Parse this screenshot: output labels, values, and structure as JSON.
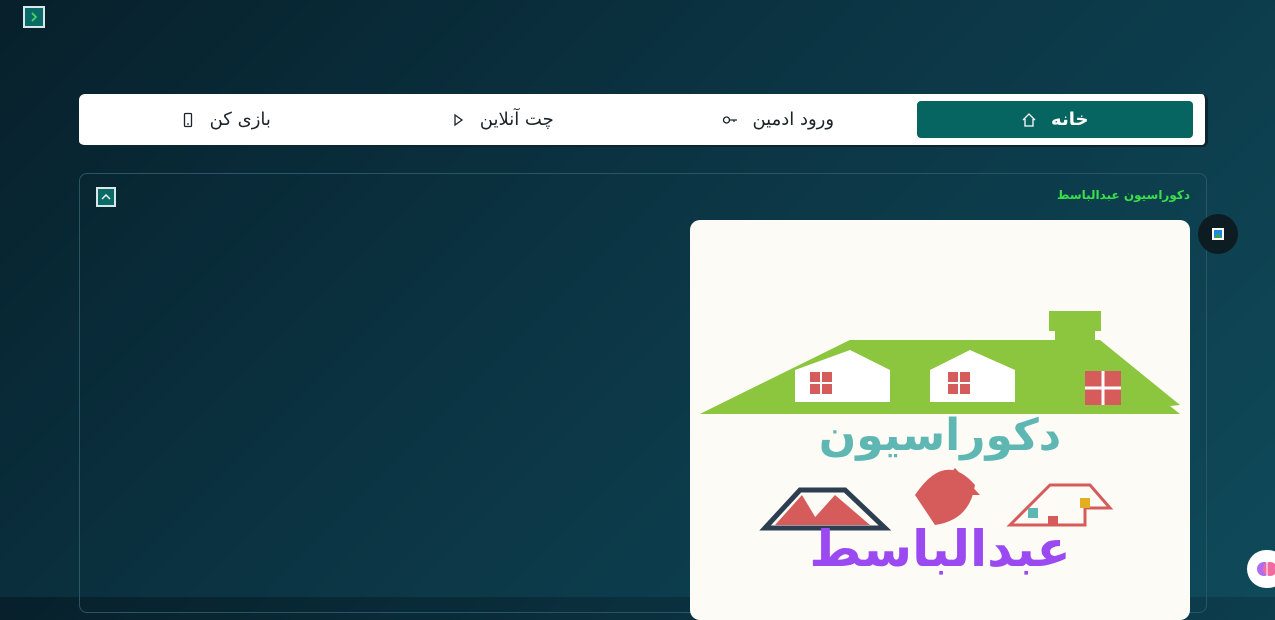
{
  "sidebar": {
    "toggle_icon": "chevron-right-icon"
  },
  "nav": {
    "tabs": [
      {
        "label": "خانه",
        "icon": "home-icon",
        "active": true
      },
      {
        "label": "ورود ادمین",
        "icon": "key-icon",
        "active": false
      },
      {
        "label": "چت آنلاین",
        "icon": "play-icon",
        "active": false
      },
      {
        "label": "بازی کن",
        "icon": "mobile-icon",
        "active": false
      }
    ]
  },
  "card": {
    "title": "دکوراسیون عبدالباسط",
    "logo": {
      "line1": "دکوراسیون",
      "line2": "عبدالباسط"
    }
  },
  "colors": {
    "accent": "#066560",
    "title_green": "#39e04a",
    "roof_green": "#8cc63f",
    "logo_teal": "#5fb7b3",
    "logo_purple": "#9a4af0",
    "logo_red": "#d65c5c"
  }
}
